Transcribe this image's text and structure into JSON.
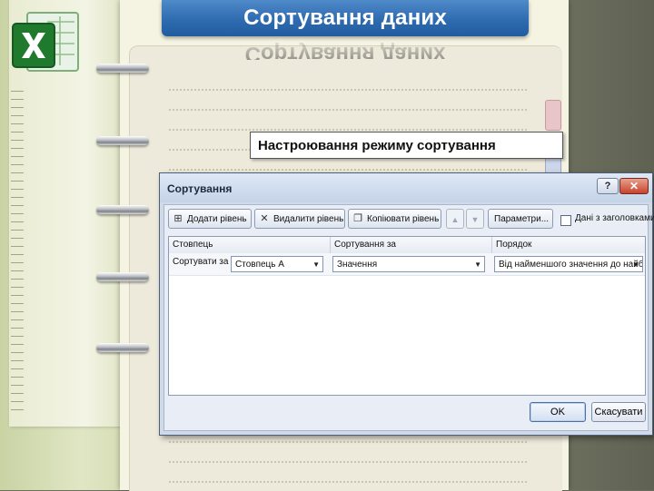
{
  "slide": {
    "title": "Сортування даних",
    "caption": "Настроювання режиму сортування",
    "logo_icon": "excel-logo-icon",
    "colors": {
      "banner": "#2e6bb0",
      "excel_green": "#1f7a2e"
    }
  },
  "dialog": {
    "title": "Сортування",
    "help_label": "?",
    "close_label": "✕",
    "toolbar": {
      "add_level": "Додати рівень",
      "delete_level": "Видалити рівень",
      "copy_level": "Копіювати рівень",
      "move_up": "▲",
      "move_down": "▼",
      "options": "Параметри...",
      "headers_checkbox": "Дані з заголовками"
    },
    "columns": [
      "Стовпець",
      "Сортування за",
      "Порядок"
    ],
    "row": {
      "label": "Сортувати за",
      "column_value": "Стовпець A",
      "sort_on_value": "Значення",
      "order_value": "Від найменшого значення до найбіл"
    },
    "ok_label": "OK",
    "cancel_label": "Скасувати"
  }
}
